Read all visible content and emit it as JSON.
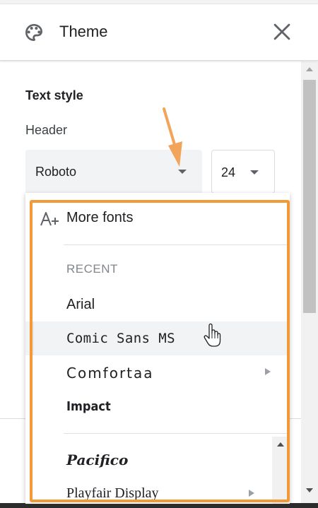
{
  "panel": {
    "title": "Theme",
    "icon": "palette-icon",
    "close_icon": "close-icon"
  },
  "text_style": {
    "heading": "Text style",
    "header_label": "Header",
    "font_select": {
      "value": "Roboto",
      "icon": "chevron-down-icon"
    },
    "size_select": {
      "value": "24",
      "icon": "chevron-down-icon"
    }
  },
  "font_menu": {
    "more_fonts": {
      "label": "More fonts",
      "icon": "add-font-icon"
    },
    "recent_label": "RECENT",
    "items": [
      {
        "label": "Arial",
        "hovered": false,
        "submenu": false
      },
      {
        "label": "Comic Sans MS",
        "hovered": true,
        "submenu": false
      },
      {
        "label": "Comfortaa",
        "hovered": false,
        "submenu": true
      },
      {
        "label": "Impact",
        "hovered": false,
        "submenu": false
      }
    ],
    "more_items": [
      {
        "label": "Pacifico",
        "submenu": false
      },
      {
        "label": "Playfair Display",
        "submenu": true
      }
    ]
  },
  "annotation": {
    "highlight_color": "#f29a38",
    "arrow_color": "#f2a55a"
  },
  "colors": {
    "hover_bg": "#f1f3f4",
    "select_bg": "#f1f3f4",
    "text": "#202124",
    "muted": "#80868b"
  }
}
